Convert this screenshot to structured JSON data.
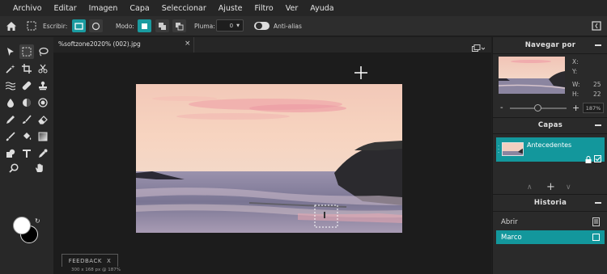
{
  "menu": [
    "Archivo",
    "Editar",
    "Imagen",
    "Capa",
    "Seleccionar",
    "Ajuste",
    "Filtro",
    "Ver",
    "Ayuda"
  ],
  "options": {
    "escribir_label": "Escribir:",
    "modo_label": "Modo:",
    "pluma_label": "Pluma:",
    "pluma_value": "0",
    "antialias_label": "Anti-alias"
  },
  "document": {
    "tab_title": "%softzone2020% (002).jpg",
    "close_glyph": "×"
  },
  "feedback": {
    "label": "FEEDBACK",
    "close": "X"
  },
  "status_text": "300 x 168 px @ 187%",
  "navigator": {
    "title": "Navegar por",
    "x_label": "X:",
    "y_label": "Y:",
    "w_label": "W:",
    "h_label": "H:",
    "w_value": "25",
    "h_value": "22",
    "zoom": "187%",
    "zoom_minus": "-",
    "zoom_plus": "+"
  },
  "layers": {
    "title": "Capas",
    "items": [
      {
        "name": "Antecedentes"
      }
    ]
  },
  "history": {
    "title": "Historia",
    "items": [
      {
        "label": "Abrir"
      },
      {
        "label": "Marco"
      }
    ]
  },
  "colors": {
    "accent": "#13979c",
    "foreground": "#ffffff",
    "background": "#000000"
  }
}
